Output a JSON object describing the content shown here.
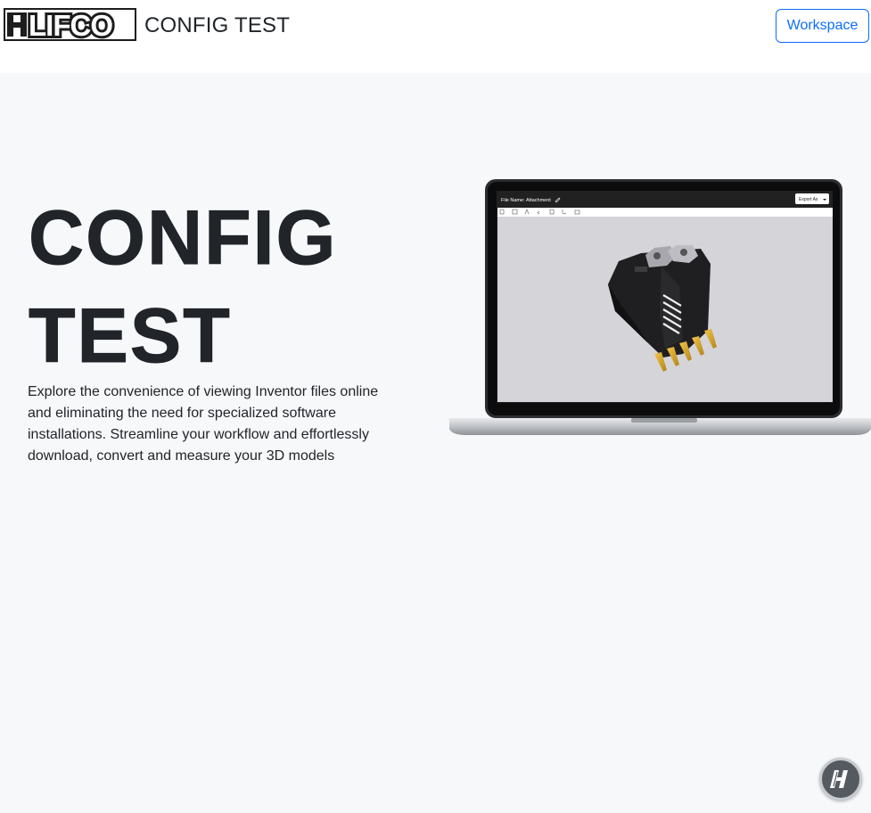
{
  "header": {
    "logo_text": "LIFCO",
    "app_title": "CONFIG TEST",
    "workspace_button": "Workspace"
  },
  "hero": {
    "title_line1": "CONFIG",
    "title_line2": "TEST",
    "description": "Explore the convenience of viewing Inventor files online and eliminating the need for specialized software installations. Streamline your workflow and effortlessly download, convert and measure your 3D models"
  },
  "preview": {
    "file_name_label": "File Name:",
    "file_name_value": "Attachment",
    "export_button": "Export As",
    "model_icon": "excavator-bucket-model"
  },
  "chat": {
    "icon": "h-logo-icon"
  },
  "colors": {
    "primary": "#0d6efd",
    "background": "#f7f8fa",
    "text": "#212529"
  }
}
